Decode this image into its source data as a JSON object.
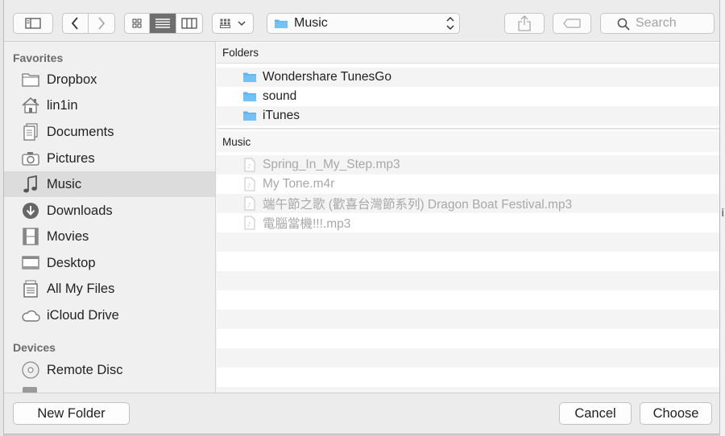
{
  "toolbar": {
    "path_popup": {
      "label": "Music"
    },
    "search": {
      "placeholder": "Search"
    }
  },
  "sidebar": {
    "favorites_header": "Favorites",
    "favorites": [
      {
        "label": "Dropbox",
        "icon": "folder-icon"
      },
      {
        "label": "lin1in",
        "icon": "home-icon"
      },
      {
        "label": "Documents",
        "icon": "documents-icon"
      },
      {
        "label": "Pictures",
        "icon": "camera-icon"
      },
      {
        "label": "Music",
        "icon": "music-note-icon",
        "selected": true
      },
      {
        "label": "Downloads",
        "icon": "download-icon"
      },
      {
        "label": "Movies",
        "icon": "film-icon"
      },
      {
        "label": "Desktop",
        "icon": "desktop-icon"
      },
      {
        "label": "All My Files",
        "icon": "all-files-icon"
      },
      {
        "label": "iCloud Drive",
        "icon": "cloud-icon"
      }
    ],
    "devices_header": "Devices",
    "devices": [
      {
        "label": "Remote Disc",
        "icon": "disc-icon"
      }
    ]
  },
  "main": {
    "folders_header": "Folders",
    "folders": [
      {
        "name": "Wondershare TunesGo"
      },
      {
        "name": "sound"
      },
      {
        "name": "iTunes"
      }
    ],
    "music_header": "Music",
    "files": [
      {
        "name": "Spring_In_My_Step.mp3"
      },
      {
        "name": "My Tone.m4r"
      },
      {
        "name": "端午節之歌 (歡喜台灣節系列) Dragon Boat Festival.mp3"
      },
      {
        "name": "電腦當機!!!.mp3"
      }
    ]
  },
  "footer": {
    "new_folder_label": "New Folder",
    "cancel_label": "Cancel",
    "choose_label": "Choose"
  },
  "colors": {
    "folder_blue": "#5fb4f0",
    "selected_row": "#dcdcdc"
  }
}
